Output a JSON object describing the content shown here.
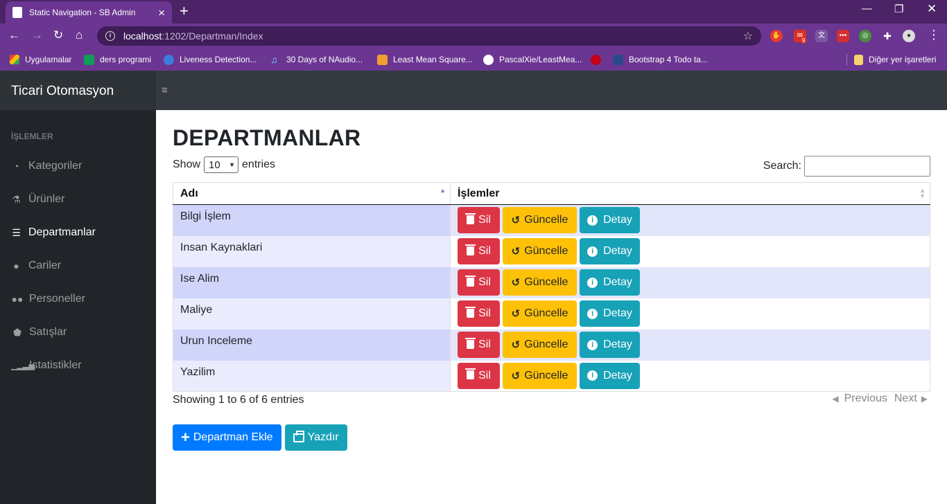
{
  "browser": {
    "tab_title": "Static Navigation - SB Admin",
    "url_host": "localhost",
    "url_path": ":1202/Departman/Index",
    "bookmarks": [
      {
        "label": "Uygulamalar"
      },
      {
        "label": "ders programi"
      },
      {
        "label": "Liveness Detection..."
      },
      {
        "label": "30 Days of NAudio..."
      },
      {
        "label": "Least Mean Square..."
      },
      {
        "label": "PascalXie/LeastMea..."
      },
      {
        "label": ""
      },
      {
        "label": "Bootstrap 4 Todo ta..."
      }
    ],
    "other_bookmarks": "Diğer yer işaretleri",
    "extension_badge": "9"
  },
  "app": {
    "brand": "Ticari Otomasyon",
    "sidebar": {
      "heading": "İŞLEMLER",
      "items": [
        {
          "label": "Kategoriler",
          "icon": "tachometer-icon"
        },
        {
          "label": "Ürünler",
          "icon": "flask-icon"
        },
        {
          "label": "Departmanlar",
          "icon": "list-icon",
          "active": true
        },
        {
          "label": "Cariler",
          "icon": "user-icon"
        },
        {
          "label": "Personeller",
          "icon": "users-icon"
        },
        {
          "label": "Satışlar",
          "icon": "tags-icon"
        },
        {
          "label": "Istatistikler",
          "icon": "signal-icon"
        }
      ]
    }
  },
  "page": {
    "title": "DEPARTMANLAR",
    "show_label": "Show",
    "entries_label": "entries",
    "page_length": "10",
    "search_label": "Search:",
    "search_value": "",
    "columns": [
      "Adı",
      "İşlemler"
    ],
    "rows": [
      {
        "name": "Bilgi İşlem"
      },
      {
        "name": "Insan Kaynaklari"
      },
      {
        "name": "Ise Alim"
      },
      {
        "name": "Maliye"
      },
      {
        "name": "Urun Inceleme"
      },
      {
        "name": "Yazilim"
      }
    ],
    "row_buttons": {
      "delete": "Sil",
      "update": "Güncelle",
      "detail": "Detay"
    },
    "info": "Showing 1 to 6 of 6 entries",
    "previous": "Previous",
    "next": "Next",
    "add_button": "Departman Ekle",
    "print_button": "Yazdır"
  },
  "colors": {
    "danger": "#dc3545",
    "warning": "#ffc107",
    "info": "#17a2b8",
    "primary": "#007bff",
    "chrome_purple": "#6b3691"
  }
}
